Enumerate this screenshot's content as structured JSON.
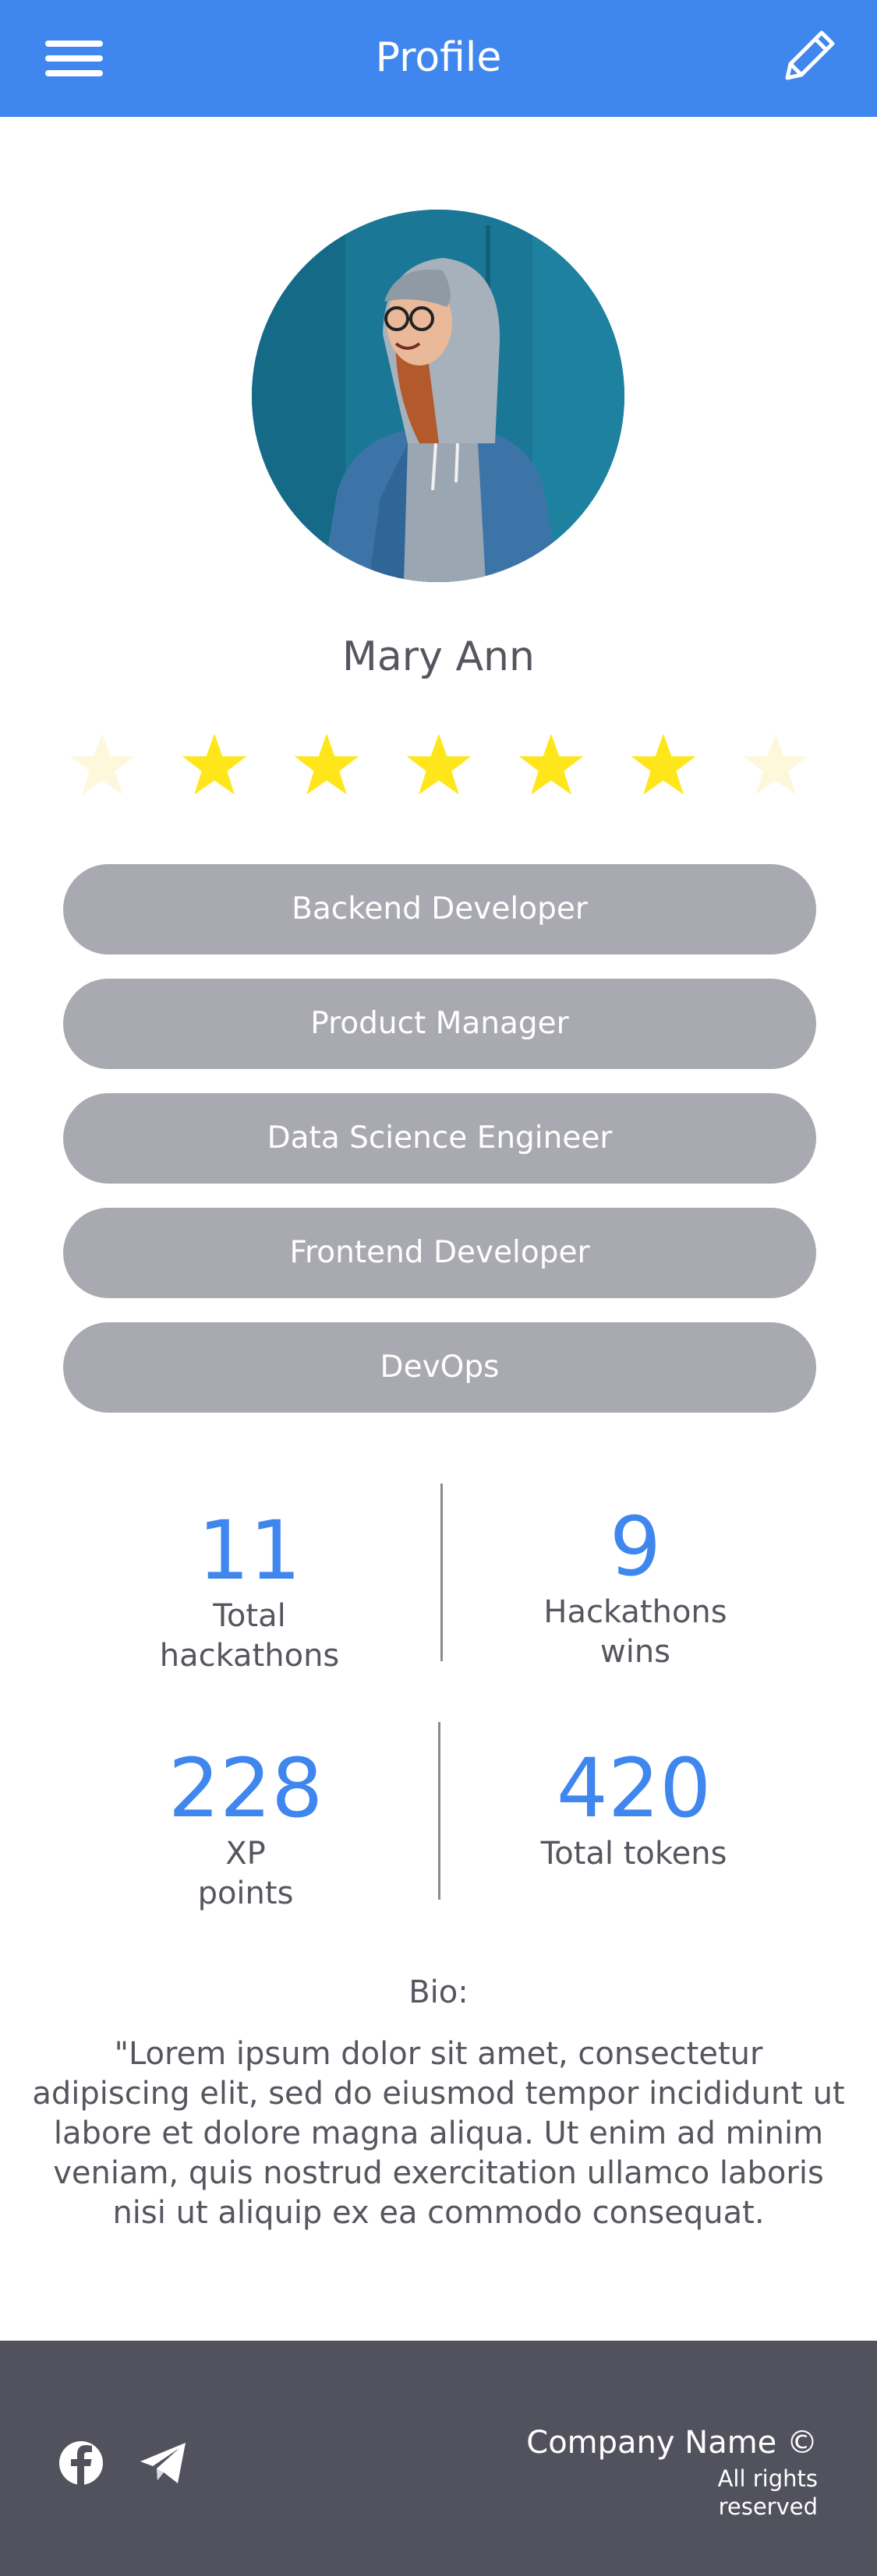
{
  "header": {
    "title": "Profile",
    "color": "#3f86ee",
    "menu_icon": "hamburger-menu-icon",
    "edit_icon": "pencil-icon"
  },
  "profile": {
    "name": "Mary Ann",
    "avatar_description": "avatar photo",
    "rating": {
      "filled": 5,
      "total": 7,
      "filled_color": "#ffe61a",
      "empty_color": "#fdf7dc"
    }
  },
  "skills": [
    "Backend Developer",
    "Product Manager",
    "Data Science Engineer",
    "Frontend Developer",
    "DevOps"
  ],
  "stats": {
    "total_hackathons": {
      "value": "11",
      "label": "Total\nhackathons"
    },
    "hackathon_wins": {
      "value": "9",
      "label": "Hackathons\nwins"
    },
    "xp_points": {
      "value": "228",
      "label": "XP\npoints"
    },
    "total_tokens": {
      "value": "420",
      "label": "Total tokens"
    }
  },
  "bio": {
    "title": "Bio:",
    "text": "\"Lorem ipsum dolor sit amet, consectetur adipiscing elit, sed do eiusmod tempor incididunt ut labore et dolore magna aliqua. Ut enim ad minim veniam, quis nostrud exercitation ullamco laboris nisi ut aliquip ex ea commodo consequat."
  },
  "footer": {
    "company": "Company Name ©",
    "rights": "All rights reserved",
    "social_icons": [
      "facebook-icon",
      "telegram-icon"
    ],
    "background": "#52525e"
  }
}
